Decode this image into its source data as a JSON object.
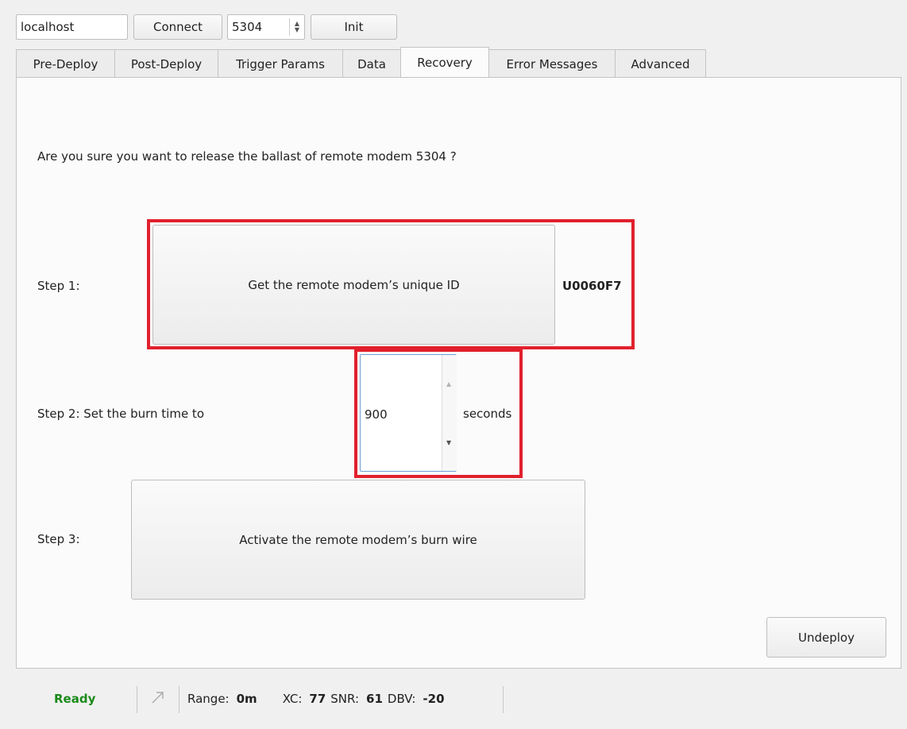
{
  "toolbar": {
    "host_value": "localhost",
    "connect_label": "Connect",
    "port_value": "5304",
    "init_label": "Init"
  },
  "tabs": [
    {
      "label": "Pre-Deploy"
    },
    {
      "label": "Post-Deploy"
    },
    {
      "label": "Trigger Params"
    },
    {
      "label": "Data"
    },
    {
      "label": "Recovery"
    },
    {
      "label": "Error Messages"
    },
    {
      "label": "Advanced"
    }
  ],
  "active_tab": "Recovery",
  "recovery": {
    "question": "Are you sure you want to release the ballast of remote modem 5304 ?",
    "step1_label": "Step 1:",
    "step1_button": "Get the remote modem’s unique ID",
    "unique_id": "U0060F7",
    "step2_label": "Step 2:  Set the burn time to",
    "burn_time_value": "900",
    "burn_time_unit": "seconds",
    "step3_label": "Step 3:",
    "step3_button": "Activate the remote modem’s burn wire",
    "undeploy_button": "Undeploy"
  },
  "status": {
    "state": "Ready",
    "range_label": "Range:",
    "range_value": "0m",
    "xc_label": "XC:",
    "xc_value": "77",
    "snr_label": "SNR:",
    "snr_value": "61",
    "dbv_label": "DBV:",
    "dbv_value": "-20"
  },
  "colors": {
    "highlight_border": "#e1202c",
    "ready_text": "#1a8a1a"
  }
}
